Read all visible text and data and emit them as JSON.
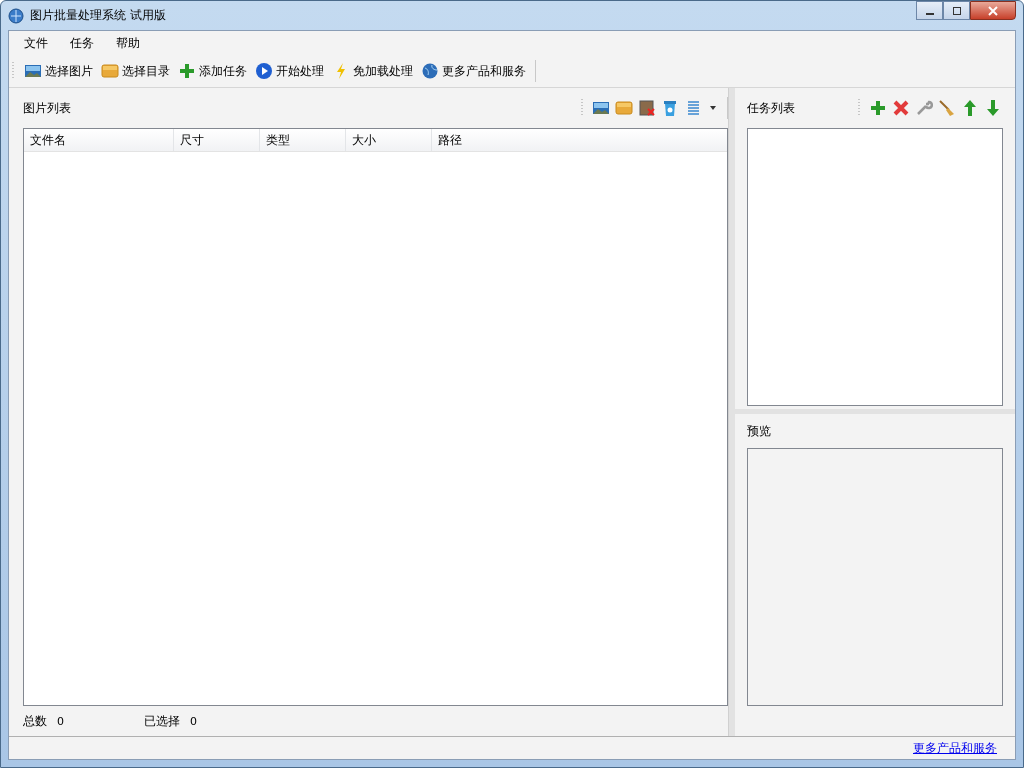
{
  "window": {
    "title": "图片批量处理系统 试用版"
  },
  "menu": [
    "文件",
    "任务",
    "帮助"
  ],
  "toolbar": [
    "选择图片",
    "选择目录",
    "添加任务",
    "开始处理",
    "免加载处理",
    "更多产品和服务"
  ],
  "image_panel": {
    "title": "图片列表",
    "columns": [
      "文件名",
      "尺寸",
      "类型",
      "大小",
      "路径"
    ],
    "total_label": "总数",
    "total": "0",
    "selected_label": "已选择",
    "selected": "0"
  },
  "task_panel": {
    "title": "任务列表"
  },
  "preview_panel": {
    "title": "预览"
  },
  "status_bar": {
    "link": "更多产品和服务"
  }
}
